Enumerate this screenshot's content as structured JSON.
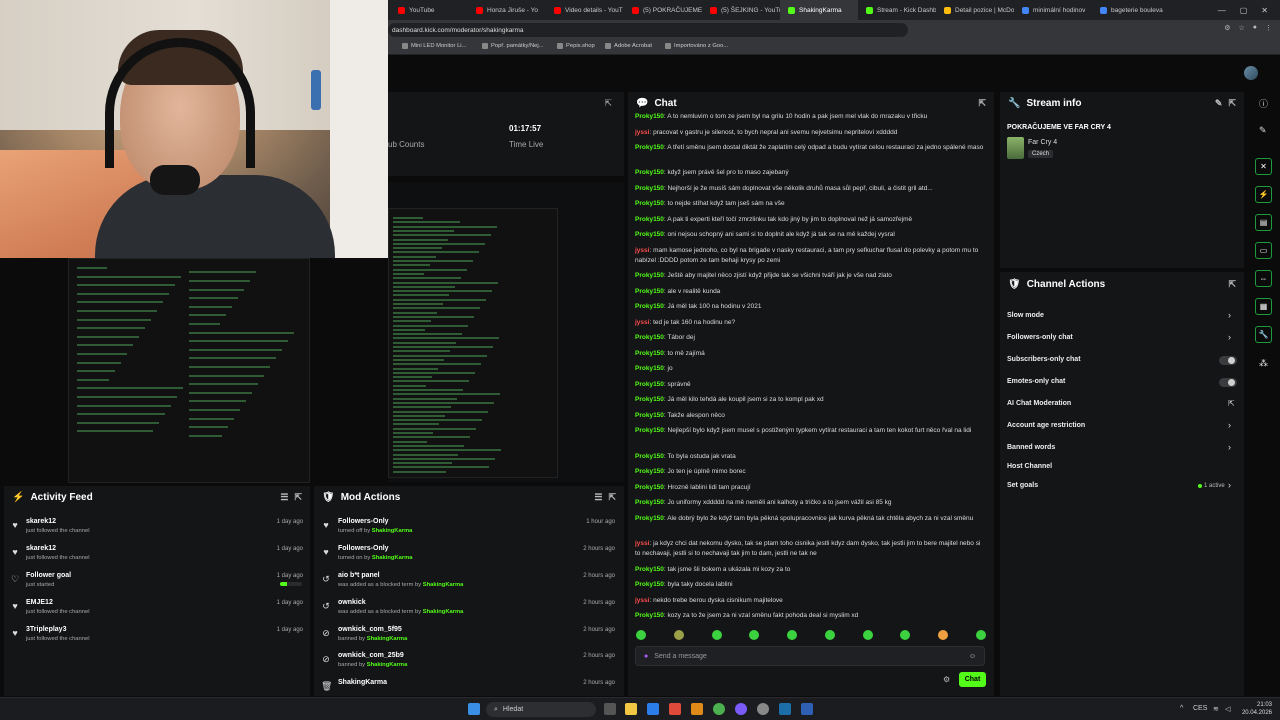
{
  "browser": {
    "tabs": [
      {
        "label": "YouTube",
        "color": "#ff0000"
      },
      {
        "label": "Honza Jiruše - Yo",
        "color": "#ff0000"
      },
      {
        "label": "Video details - YouT",
        "color": "#ff0000"
      },
      {
        "label": "(5) POKRAČUJEME",
        "color": "#ff0000"
      },
      {
        "label": "(5) ŠEJKING - YouTu",
        "color": "#ff0000"
      },
      {
        "label": "ShakingKarma",
        "color": "#53fc18",
        "active": true
      },
      {
        "label": "Stream - Kick Dashb",
        "color": "#53fc18"
      },
      {
        "label": "Detail pozice | McDo",
        "color": "#ffbc0d"
      },
      {
        "label": "minimální hodinov",
        "color": "#4285f4"
      },
      {
        "label": "bageterie bouleva",
        "color": "#4285f4"
      }
    ],
    "url": "dashboard.kick.com/moderator/shakingkarma",
    "bookmarks": [
      "Mini LED Monitor Li...",
      "Popř. památky/Nej...",
      "Pepis.shop",
      "Adobe Acrobat",
      "Importováno z Goo..."
    ]
  },
  "stats": {
    "sub_counts_label": "ub Counts",
    "time_live_value": "01:17:57",
    "time_live_label": "Time Live"
  },
  "chat": {
    "title": "Chat",
    "placeholder": "Send a message",
    "send_label": "Chat",
    "messages": [
      {
        "user": "Proky150",
        "color": "green",
        "text": "A to nemluvim o tom ze jsem byl na grilu 10 hodin a pak jsem mel vlak do mrazaku v třicku"
      },
      {
        "user": "jyssi",
        "color": "red",
        "text": "pracovat v gastru je silenost, to bych nepral ani svemu nejvetsimu nepriteloví xddddd"
      },
      {
        "user": "Proky150",
        "color": "green",
        "text": "A třetí směnu jsem dostal diktát že zaplatím celý odpad a budu vytírat celou restauraci za jedno spálené maso"
      },
      {
        "user": "Proky150",
        "color": "green",
        "text": "když jsem právě šel pro to maso zajebaný"
      },
      {
        "user": "Proky150",
        "color": "green",
        "text": "Nejhorší je že musíš sám doplnovat vše několik druhů masa sůl pepř, cibuli, a čistit gril atd..."
      },
      {
        "user": "Proky150",
        "color": "green",
        "text": "to nejde stíhat když tam jseš sám na vše"
      },
      {
        "user": "Proky150",
        "color": "green",
        "text": "A pak ti experti kteří točí zmrzlinku tak kdo jiný by jim to doplnoval než já samozřejmě"
      },
      {
        "user": "Proky150",
        "color": "green",
        "text": "oni nejsou schopný ani sami si to doplnit ale když já tak se na mě každej vysral"
      },
      {
        "user": "jyssi",
        "color": "red",
        "text": "mam kamose jednoho, co byl na brigade v nasky restauraci, a tam pry sefkuchar flusal do polevky a potom mu to nabízel :DDDD potom ze tam behaji krysy po zemi"
      },
      {
        "user": "Proky150",
        "color": "green",
        "text": "Ještě aby majitel něco zjistí když přijde tak se všichni tváří jak je vše nad zlato"
      },
      {
        "user": "Proky150",
        "color": "green",
        "text": "ale v realitě kunda"
      },
      {
        "user": "Proky150",
        "color": "green",
        "text": "Já měl tak 100 na hodinu v 2021"
      },
      {
        "user": "jyssi",
        "color": "red",
        "text": "ted je tak 160 na hodinu ne?"
      },
      {
        "user": "Proky150",
        "color": "green",
        "text": "Tábor dej"
      },
      {
        "user": "Proky150",
        "color": "green",
        "text": "to mě zajímá"
      },
      {
        "user": "Proky150",
        "color": "green",
        "text": "jo"
      },
      {
        "user": "Proky150",
        "color": "green",
        "text": "správně"
      },
      {
        "user": "Proky150",
        "color": "green",
        "text": "Já měl kilo tehdá ale koupil jsem si za to kompl pak xd"
      },
      {
        "user": "Proky150",
        "color": "green",
        "text": "Takže alespon něco"
      },
      {
        "user": "Proky150",
        "color": "green",
        "text": "Nejlepší bylo když jsem musel s postiženým typkem vytírat restauraci a tam ten kokot furt něco řval na lidi"
      },
      {
        "user": "Proky150",
        "color": "green",
        "text": "To byla ostuda jak vrata"
      },
      {
        "user": "Proky150",
        "color": "green",
        "text": "Jo ten je úplně mimo borec"
      },
      {
        "user": "Proky150",
        "color": "green",
        "text": "Hrozně lablini lidi tam pracují"
      },
      {
        "user": "Proky150",
        "color": "green",
        "text": "Jo uniformy xddddd na mě neměli ani kalhoty a tričko a to jsem vážil asi 85 kg"
      },
      {
        "user": "Proky150",
        "color": "green",
        "text": "Ale dobrý bylo že když tam byla pěkná spolupracovnice jak kurva pěkná tak chtěla abych za ni vzal směnu"
      },
      {
        "user": "jyssi",
        "color": "red",
        "text": "ja kdyz chci dat nekomu dysko, tak se ptam toho cisnika jestli kdyz dam dysko, tak jestli jim to bere majitel nebo si to nechavaji, jestli si to nechavaji tak jim to dam, jestli ne tak ne"
      },
      {
        "user": "Proky150",
        "color": "green",
        "text": "tak jsme šli bokem a ukázala mi kozy za to"
      },
      {
        "user": "Proky150",
        "color": "green",
        "text": "byla taky docela lablini"
      },
      {
        "user": "jyssi",
        "color": "red",
        "text": "nekdo trebe berou dyska cisnikum majitelove"
      },
      {
        "user": "Proky150",
        "color": "green",
        "text": "kozy za to že jsem za ni vzal směnu fakt pohoda deal si myslim xd"
      }
    ]
  },
  "stream_info": {
    "title": "Stream info",
    "stream_title": "POKRAČUJEME VE FAR CRY 4",
    "game": "Far Cry 4",
    "language": "Czech"
  },
  "channel_actions": {
    "title": "Channel Actions",
    "items": [
      {
        "label": "Slow mode",
        "control": "chevron"
      },
      {
        "label": "Followers-only chat",
        "control": "chevron"
      },
      {
        "label": "Subscribers-only chat",
        "control": "toggle"
      },
      {
        "label": "Emotes-only chat",
        "control": "toggle"
      },
      {
        "label": "AI Chat Moderation",
        "control": "external"
      },
      {
        "label": "Account age restriction",
        "control": "chevron"
      },
      {
        "label": "Banned words",
        "control": "chevron"
      },
      {
        "label": "Host Channel",
        "control": "none"
      },
      {
        "label": "Set goals",
        "control": "chevron"
      }
    ],
    "goals_status": "1 active"
  },
  "activity_feed": {
    "title": "Activity Feed",
    "items": [
      {
        "name": "skarek12",
        "sub": "just followed the channel",
        "time": "1 day ago",
        "icon": "heart"
      },
      {
        "name": "skarek12",
        "sub": "just followed the channel",
        "time": "1 day ago",
        "icon": "heart"
      },
      {
        "name": "Follower goal",
        "sub": "just started",
        "time": "1 day ago",
        "icon": "heart-outline"
      },
      {
        "name": "EMJE12",
        "sub": "just followed the channel",
        "time": "1 day ago",
        "icon": "heart"
      },
      {
        "name": "3Tripleplay3",
        "sub": "just followed the channel",
        "time": "1 day ago",
        "icon": "heart"
      }
    ],
    "goal_progress": 0.3
  },
  "mod_actions": {
    "title": "Mod Actions",
    "items": [
      {
        "name": "Followers-Only",
        "sub": "turned off by",
        "by": "ShakingKarma",
        "time": "1 hour ago",
        "icon": "heart"
      },
      {
        "name": "Followers-Only",
        "sub": "turned on by",
        "by": "ShakingKarma",
        "time": "2 hours ago",
        "icon": "heart"
      },
      {
        "name": "aio b*t panel",
        "sub": "was added as a blocked term by",
        "by": "ShakingKarma",
        "time": "2 hours ago",
        "icon": "undo"
      },
      {
        "name": "ownkick",
        "sub": "was added as a blocked term by",
        "by": "ShakingKarma",
        "time": "2 hours ago",
        "icon": "undo"
      },
      {
        "name": "ownkick_com_5f95",
        "sub": "banned by",
        "by": "ShakingKarma",
        "time": "2 hours ago",
        "icon": "ban"
      },
      {
        "name": "ownkick_com_25b9",
        "sub": "banned by",
        "by": "ShakingKarma",
        "time": "2 hours ago",
        "icon": "ban"
      },
      {
        "name": "ShakingKarma",
        "sub": "",
        "by": "",
        "time": "2 hours ago",
        "icon": "trash"
      }
    ]
  },
  "taskbar": {
    "search_placeholder": "Hledat",
    "language": "CES",
    "time": "21:03",
    "date": "20.04.2026"
  },
  "colors": {
    "kick_green": "#53fc18",
    "panel_bg": "#141517",
    "page_bg": "#0b0b0c"
  }
}
